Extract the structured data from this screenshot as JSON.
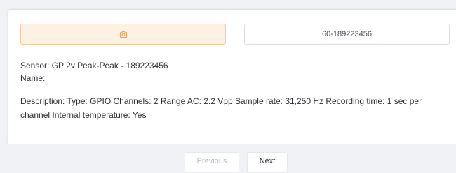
{
  "toolbar": {
    "camera_icon": "camera-icon",
    "sensor_id_label": "60-189223456"
  },
  "details": {
    "sensor_line": "Sensor: GP 2v Peak-Peak - 189223456",
    "name_line": "Name:",
    "description_line": "Description: Type: GPIO Channels: 2 Range AC: 2.2 Vpp Sample rate: 31,250 Hz Recording time: 1 sec per channel Internal temperature: Yes"
  },
  "pagination": {
    "previous_label": "Previous",
    "next_label": "Next",
    "previous_disabled": true
  },
  "colors": {
    "camera_button_bg": "#fdf1e4",
    "camera_button_border": "#f2c9a4",
    "camera_icon": "#f0a262",
    "page_bg": "#f1f2f6"
  }
}
